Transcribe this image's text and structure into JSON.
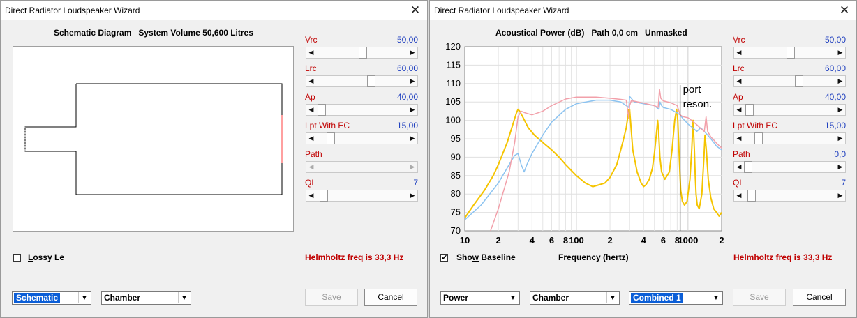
{
  "left_window": {
    "title": "Direct Radiator Loudspeaker Wizard",
    "caption": "Schematic Diagram   System Volume 50,600 Litres",
    "params": [
      {
        "label": "Vrc",
        "value": "50,00",
        "level": 0.5,
        "enabled": true
      },
      {
        "label": "Lrc",
        "value": "60,00",
        "level": 0.6,
        "enabled": true
      },
      {
        "label": "Ap",
        "value": "40,00",
        "level": 0.02,
        "enabled": true
      },
      {
        "label": "Lpt  With EC",
        "value": "15,00",
        "level": 0.12,
        "enabled": true
      },
      {
        "label": "Path",
        "value": "",
        "level": 0.0,
        "enabled": false
      },
      {
        "label": "QL",
        "value": "7",
        "level": 0.04,
        "enabled": true
      }
    ],
    "lossy_label": "Lossy Le",
    "lossy_checked": false,
    "helmholtz": "Helmholtz freq is 33,3 Hz",
    "view_select": "Schematic",
    "mode_select": "Chamber",
    "save_label": "Save",
    "cancel_label": "Cancel"
  },
  "right_window": {
    "title": "Direct Radiator Loudspeaker Wizard",
    "caption": "Acoustical Power (dB)   Path 0,0 cm   Unmasked",
    "params": [
      {
        "label": "Vrc",
        "value": "50,00",
        "level": 0.5,
        "enabled": true
      },
      {
        "label": "Lrc",
        "value": "60,00",
        "level": 0.6,
        "enabled": true
      },
      {
        "label": "Ap",
        "value": "40,00",
        "level": 0.02,
        "enabled": true
      },
      {
        "label": "Lpt  With EC",
        "value": "15,00",
        "level": 0.12,
        "enabled": true
      },
      {
        "label": "Path",
        "value": "0,0",
        "level": 0.0,
        "enabled": true
      },
      {
        "label": "QL",
        "value": "7",
        "level": 0.04,
        "enabled": true
      }
    ],
    "baseline_label": "Show Baseline",
    "baseline_checked": true,
    "xlabel": "Frequency (hertz)",
    "helmholtz": "Helmholtz freq is 33,3 Hz",
    "view_select": "Power",
    "mode_select": "Chamber",
    "combined_select": "Combined 1",
    "save_label": "Save",
    "cancel_label": "Cancel"
  },
  "colors": {
    "param_label": "#c00000",
    "param_value": "#1f3fbf",
    "series_yellow": "#f5c400",
    "series_blue": "#8cc3f0",
    "series_pink": "#f2a0aa"
  },
  "chart_data": {
    "type": "line",
    "title": "Acoustical Power (dB)   Path 0,0 cm   Unmasked",
    "xlabel": "Frequency (hertz)",
    "ylabel": "",
    "xscale": "log",
    "xlim": [
      10,
      2000
    ],
    "ylim": [
      70,
      120
    ],
    "grid": true,
    "yticks": [
      70,
      75,
      80,
      85,
      90,
      95,
      100,
      105,
      110,
      115,
      120
    ],
    "xtick_labels": [
      {
        "f": 10,
        "label": "10"
      },
      {
        "f": 20,
        "label": "2"
      },
      {
        "f": 40,
        "label": "4"
      },
      {
        "f": 60,
        "label": "6"
      },
      {
        "f": 80,
        "label": "8"
      },
      {
        "f": 100,
        "label": "100"
      },
      {
        "f": 200,
        "label": "2"
      },
      {
        "f": 400,
        "label": "4"
      },
      {
        "f": 600,
        "label": "6"
      },
      {
        "f": 800,
        "label": "8"
      },
      {
        "f": 1000,
        "label": "1000"
      },
      {
        "f": 2000,
        "label": "2"
      }
    ],
    "annotation": {
      "text": [
        "port",
        "reson."
      ],
      "x": 850
    },
    "series": [
      {
        "color": "#f5c400",
        "width": 2,
        "x": [
          10,
          12,
          15,
          18,
          20,
          24,
          27,
          29,
          30,
          31,
          33,
          37,
          42,
          50,
          60,
          70,
          80,
          100,
          120,
          140,
          160,
          180,
          200,
          230,
          260,
          280,
          295,
          300,
          305,
          320,
          350,
          380,
          400,
          420,
          450,
          480,
          500,
          520,
          535,
          545,
          560,
          580,
          620,
          680,
          720,
          760,
          790,
          810,
          830,
          845,
          860,
          890,
          930,
          980,
          1040,
          1080,
          1110,
          1140,
          1160,
          1180,
          1210,
          1260,
          1330,
          1390,
          1420,
          1460,
          1520,
          1600,
          1700,
          1800,
          1900,
          2000
        ],
        "y": [
          73.5,
          77,
          81,
          85,
          88,
          94,
          99,
          102,
          103,
          102.5,
          101,
          98,
          96,
          94,
          92,
          90,
          88,
          85,
          83,
          82,
          82.5,
          83,
          84.5,
          88,
          94,
          98,
          103,
          103,
          100,
          92,
          86,
          83,
          82,
          82.5,
          84,
          87,
          91,
          96,
          100,
          97,
          90,
          86,
          84,
          86,
          92,
          100,
          103,
          100,
          92,
          86,
          81,
          78,
          77,
          78,
          84,
          92,
          100,
          92,
          85,
          80,
          77,
          76,
          80,
          90,
          96,
          92,
          84,
          79,
          76,
          75,
          74,
          75
        ]
      },
      {
        "color": "#8cc3f0",
        "width": 1.5,
        "x": [
          10,
          14,
          20,
          25,
          28,
          30,
          32,
          34,
          36,
          40,
          50,
          60,
          80,
          100,
          150,
          200,
          250,
          280,
          295,
          300,
          310,
          330,
          400,
          500,
          550,
          560,
          580,
          600,
          700,
          800,
          850,
          900,
          1000,
          1100,
          1200,
          1300,
          1400,
          1500,
          1600,
          1700,
          1800,
          2000
        ],
        "y": [
          73,
          77,
          83,
          88,
          90.5,
          91,
          88,
          86,
          88,
          91,
          96,
          99.5,
          103,
          104.5,
          105.5,
          105.5,
          105,
          104,
          103.5,
          106.5,
          106,
          105,
          104.5,
          104,
          103,
          105,
          104,
          103.5,
          103,
          102,
          101.5,
          100.5,
          99,
          98,
          97,
          98,
          97,
          96,
          95,
          94,
          93,
          92
        ]
      },
      {
        "color": "#f2a0aa",
        "width": 1.5,
        "x": [
          17,
          20,
          25,
          28,
          30,
          32,
          35,
          40,
          50,
          60,
          80,
          100,
          150,
          200,
          250,
          280,
          290,
          295,
          300,
          310,
          330,
          400,
          500,
          540,
          555,
          570,
          600,
          700,
          800,
          850,
          900,
          1000,
          1100,
          1200,
          1300,
          1400,
          1450,
          1500,
          1600,
          1700,
          1800,
          2000
        ],
        "y": [
          70,
          76,
          86,
          94,
          101,
          102.5,
          102,
          101.5,
          102.5,
          104,
          105.8,
          106.3,
          106.3,
          106,
          105.7,
          105.5,
          102,
          100.5,
          104,
          105.3,
          105.2,
          104.7,
          104,
          103.5,
          108.5,
          106,
          105.3,
          104.8,
          104,
          101.5,
          101,
          100.7,
          99.8,
          98.8,
          97.8,
          97,
          101,
          97,
          95.5,
          94.7,
          93.8,
          92.5
        ]
      }
    ]
  }
}
